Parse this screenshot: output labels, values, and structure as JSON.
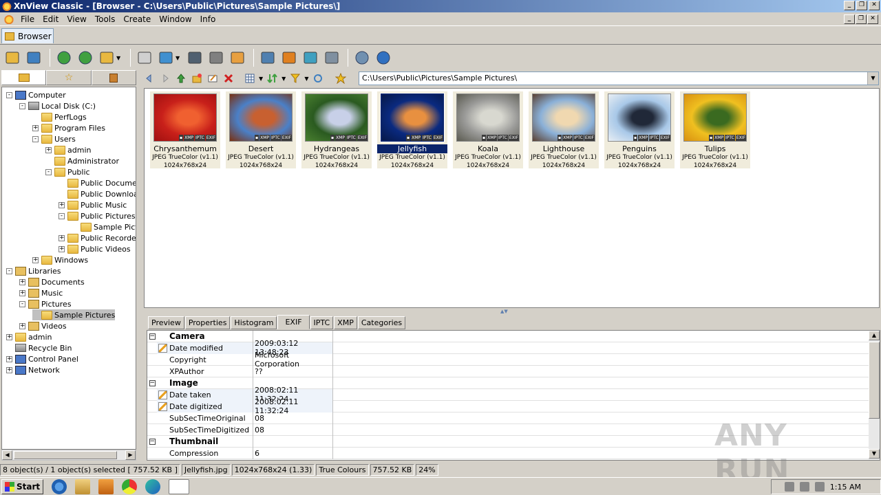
{
  "window": {
    "title": "XnView Classic - [Browser - C:\\Users\\Public\\Pictures\\Sample Pictures\\]"
  },
  "menu": [
    "File",
    "Edit",
    "View",
    "Tools",
    "Create",
    "Window",
    "Info"
  ],
  "tabs": {
    "browser": "Browser"
  },
  "toolbar": {
    "icons": [
      "open-folder",
      "fullscreen",
      "refresh",
      "rotate",
      "export",
      "properties",
      "convert",
      "find",
      "print",
      "slideshow",
      "capture",
      "wallpaper",
      "web",
      "grid",
      "settings",
      "about"
    ]
  },
  "address": "C:\\Users\\Public\\Pictures\\Sample Pictures\\",
  "tree": [
    {
      "label": "Computer",
      "icon": "computer",
      "exp": "-"
    },
    {
      "label": "Local Disk (C:)",
      "icon": "disk",
      "exp": "-"
    },
    {
      "label": "PerfLogs",
      "icon": "folder",
      "exp": ""
    },
    {
      "label": "Program Files",
      "icon": "folder",
      "exp": "+"
    },
    {
      "label": "Users",
      "icon": "folder",
      "exp": "-"
    },
    {
      "label": "admin",
      "icon": "folder",
      "exp": "+"
    },
    {
      "label": "Administrator",
      "icon": "folder",
      "exp": ""
    },
    {
      "label": "Public",
      "icon": "folder",
      "exp": "-"
    },
    {
      "label": "Public Documents",
      "icon": "folder",
      "exp": ""
    },
    {
      "label": "Public Downloads",
      "icon": "folder",
      "exp": ""
    },
    {
      "label": "Public Music",
      "icon": "folder",
      "exp": "+"
    },
    {
      "label": "Public Pictures",
      "icon": "folder",
      "exp": "-"
    },
    {
      "label": "Sample Pictures",
      "icon": "folder",
      "exp": ""
    },
    {
      "label": "Public Recorded TV",
      "icon": "folder",
      "exp": "+"
    },
    {
      "label": "Public Videos",
      "icon": "folder",
      "exp": "+"
    },
    {
      "label": "Windows",
      "icon": "folder",
      "exp": "+"
    },
    {
      "label": "Libraries",
      "icon": "library",
      "exp": "-"
    },
    {
      "label": "Documents",
      "icon": "library",
      "exp": "+"
    },
    {
      "label": "Music",
      "icon": "library",
      "exp": "+"
    },
    {
      "label": "Pictures",
      "icon": "library",
      "exp": "-"
    },
    {
      "label": "Sample Pictures",
      "icon": "folder",
      "exp": "",
      "selected": true
    },
    {
      "label": "Videos",
      "icon": "library",
      "exp": "+"
    },
    {
      "label": "admin",
      "icon": "user",
      "exp": "+"
    },
    {
      "label": "Recycle Bin",
      "icon": "recycle",
      "exp": ""
    },
    {
      "label": "Control Panel",
      "icon": "control",
      "exp": "+"
    },
    {
      "label": "Network",
      "icon": "network",
      "exp": "+"
    }
  ],
  "thumbnails": [
    {
      "name": "Chrysanthemum",
      "format": "JPEG TrueColor (v1.1)",
      "dims": "1024x768x24",
      "colors": [
        "#c8201a",
        "#f06030",
        "#a01010"
      ]
    },
    {
      "name": "Desert",
      "format": "JPEG TrueColor (v1.1)",
      "dims": "1024x768x24",
      "colors": [
        "#4a80c8",
        "#c86030",
        "#7a3010"
      ]
    },
    {
      "name": "Hydrangeas",
      "format": "JPEG TrueColor (v1.1)",
      "dims": "1024x768x24",
      "colors": [
        "#2a5a20",
        "#c8d0e8",
        "#4a8030"
      ]
    },
    {
      "name": "Jellyfish",
      "format": "JPEG TrueColor (v1.1)",
      "dims": "1024x768x24",
      "colors": [
        "#0a2a80",
        "#e89040",
        "#061848"
      ],
      "selected": true
    },
    {
      "name": "Koala",
      "format": "JPEG TrueColor (v1.1)",
      "dims": "1024x768x24",
      "colors": [
        "#9a9a98",
        "#d8d8d0",
        "#5a5a50"
      ]
    },
    {
      "name": "Lighthouse",
      "format": "JPEG TrueColor (v1.1)",
      "dims": "1024x768x24",
      "colors": [
        "#8ab0d8",
        "#f0d8b0",
        "#5a4030"
      ]
    },
    {
      "name": "Penguins",
      "format": "JPEG TrueColor (v1.1)",
      "dims": "1024x768x24",
      "colors": [
        "#a8c8e8",
        "#202838",
        "#e8eef4"
      ]
    },
    {
      "name": "Tulips",
      "format": "JPEG TrueColor (v1.1)",
      "dims": "1024x768x24",
      "colors": [
        "#f0c020",
        "#3a6a20",
        "#d89010"
      ]
    }
  ],
  "thumb_badges": [
    "XMP",
    "IPTC",
    "EXIF"
  ],
  "info_tabs": [
    "Preview",
    "Properties",
    "Histogram",
    "EXIF",
    "IPTC",
    "XMP",
    "Categories"
  ],
  "info_active": "EXIF",
  "exif_rows": [
    {
      "type": "group",
      "name": "Camera"
    },
    {
      "type": "item",
      "name": "Date modified",
      "value": "2009:03:12 13:48:23",
      "edit": true
    },
    {
      "type": "item",
      "name": "Copyright",
      "value": "Microsoft Corporation"
    },
    {
      "type": "item",
      "name": "XPAuthor",
      "value": "??"
    },
    {
      "type": "group",
      "name": "Image"
    },
    {
      "type": "item",
      "name": "Date taken",
      "value": "2008:02:11 11:32:24",
      "edit": true
    },
    {
      "type": "item",
      "name": "Date digitized",
      "value": "2008:02:11 11:32:24",
      "edit": true
    },
    {
      "type": "item",
      "name": "SubSecTimeOriginal",
      "value": "08"
    },
    {
      "type": "item",
      "name": "SubSecTimeDigitized",
      "value": "08"
    },
    {
      "type": "group",
      "name": "Thumbnail"
    },
    {
      "type": "item",
      "name": "Compression",
      "value": "6"
    }
  ],
  "status": [
    "8 object(s) / 1 object(s) selected  [ 757.52 KB ]",
    "Jellyfish.jpg",
    "1024x768x24 (1.33)",
    "True Colours",
    "757.52 KB",
    "24%"
  ],
  "taskbar": {
    "start": "Start",
    "clock": "1:15 AM"
  },
  "watermark": "ANY RUN"
}
